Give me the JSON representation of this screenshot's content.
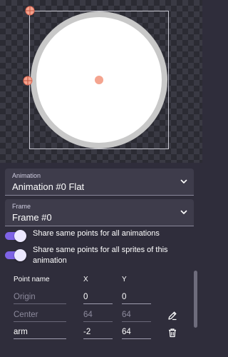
{
  "animation_field": {
    "label": "Animation",
    "value": "Animation #0 Flat"
  },
  "frame_field": {
    "label": "Frame",
    "value": "Frame #0"
  },
  "toggles": [
    {
      "label": "Share same points for all animations",
      "on": true
    },
    {
      "label": "Share same points for all sprites of this animation",
      "on": true
    }
  ],
  "points_table": {
    "headers": {
      "name": "Point name",
      "x": "X",
      "y": "Y"
    },
    "rows": [
      {
        "name": "Origin",
        "x": "0",
        "y": "0"
      },
      {
        "name": "Center",
        "x": "64",
        "y": "64",
        "action_icon": "pencil-icon"
      },
      {
        "name": "arm",
        "x": "-2",
        "y": "64",
        "action_icon": "trash-icon"
      }
    ]
  },
  "colors": {
    "panel_bg": "#2f2d3b",
    "field_bg": "#3e3c4b",
    "accent": "#7e63e6",
    "point_marker": "#f4a48f"
  }
}
